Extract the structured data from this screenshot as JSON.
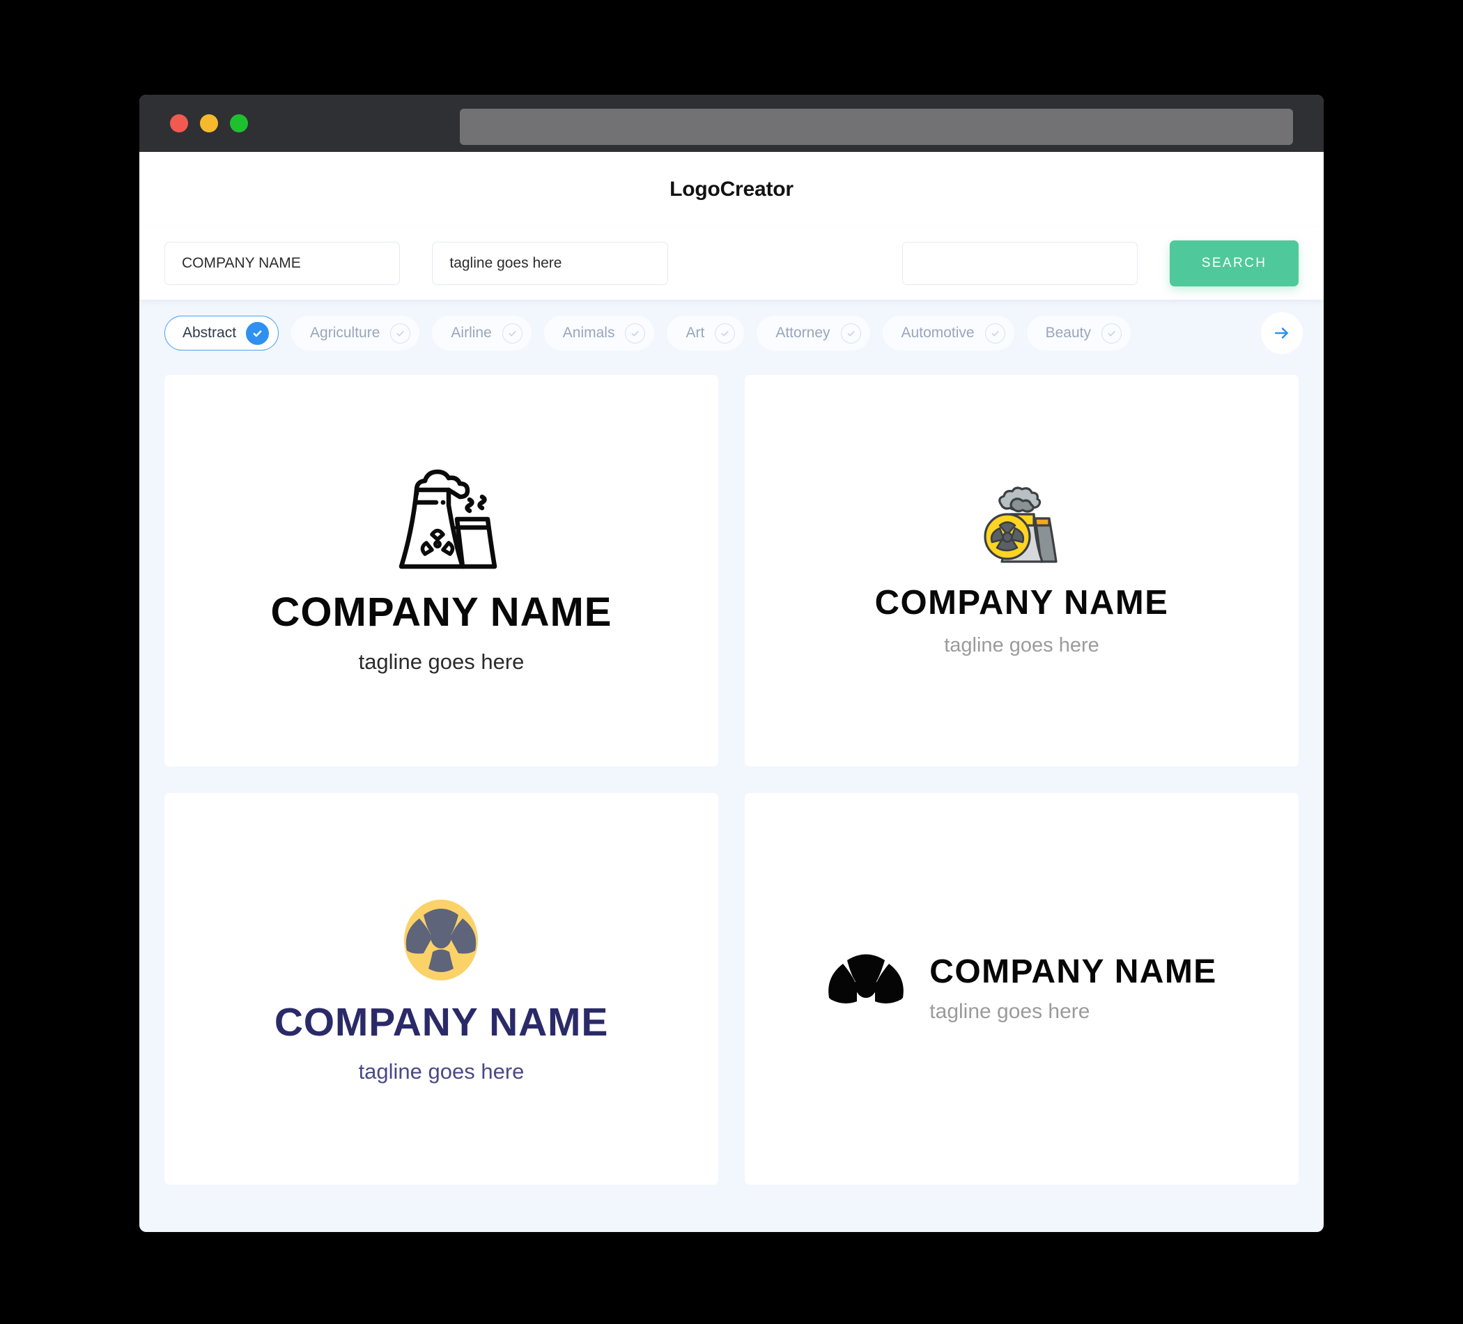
{
  "window": {
    "traffic_lights": [
      {
        "name": "close",
        "color": "#f25a51"
      },
      {
        "name": "minimize",
        "color": "#f7b92c"
      },
      {
        "name": "maximize",
        "color": "#1fc02e"
      }
    ],
    "url_value": ""
  },
  "header": {
    "title": "LogoCreator"
  },
  "search": {
    "company_value": "COMPANY NAME",
    "company_placeholder": "COMPANY NAME",
    "tagline_value": "tagline goes here",
    "tagline_placeholder": "tagline goes here",
    "extra_value": "",
    "extra_placeholder": "",
    "button_label": "SEARCH",
    "button_color": "#4fc99b"
  },
  "categories": {
    "active": "Abstract",
    "accent_color": "#2f90f0",
    "items": [
      {
        "label": "Abstract",
        "selected": true
      },
      {
        "label": "Agriculture",
        "selected": false
      },
      {
        "label": "Airline",
        "selected": false
      },
      {
        "label": "Animals",
        "selected": false
      },
      {
        "label": "Art",
        "selected": false
      },
      {
        "label": "Attorney",
        "selected": false
      },
      {
        "label": "Automotive",
        "selected": false
      },
      {
        "label": "Beauty",
        "selected": false
      }
    ],
    "next_icon": "arrow-right-icon"
  },
  "results": [
    {
      "icon": "nuclear-power-plant-outline-icon",
      "name": "COMPANY NAME",
      "tagline": "tagline goes here",
      "name_color": "#080808",
      "tagline_color": "#2b2b2b",
      "layout": "stacked"
    },
    {
      "icon": "nuclear-power-plant-color-icon",
      "name": "COMPANY NAME",
      "tagline": "tagline goes here",
      "name_color": "#080808",
      "tagline_color": "#9b9b9b",
      "layout": "stacked"
    },
    {
      "icon": "radiation-badge-icon",
      "name": "COMPANY NAME",
      "tagline": "tagline goes here",
      "name_color": "#2b2a68",
      "tagline_color": "#4a4a86",
      "layout": "stacked"
    },
    {
      "icon": "radiation-trefoil-icon",
      "name": "COMPANY NAME",
      "tagline": "tagline goes here",
      "name_color": "#060606",
      "tagline_color": "#9b9b9b",
      "layout": "horizontal"
    }
  ]
}
